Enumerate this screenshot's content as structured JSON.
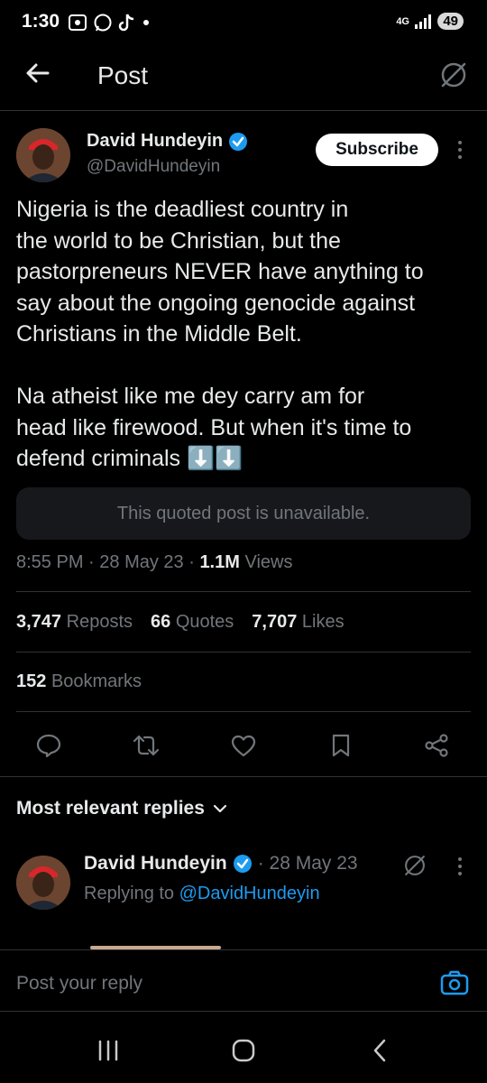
{
  "status_bar": {
    "time": "1:30",
    "network": "4G",
    "battery": "49"
  },
  "header": {
    "title": "Post"
  },
  "author": {
    "name": "David Hundeyin",
    "handle": "@DavidHundeyin"
  },
  "subscribe_label": "Subscribe",
  "tweet": {
    "text": "Nigeria is the deadliest country in\nthe world to be Christian, but the\npastorpreneurs NEVER have anything to\nsay about the ongoing genocide against\nChristians in the Middle Belt.\n\nNa atheist like me dey carry am for\nhead like firewood. But when it's time to\ndefend criminals ⬇️⬇️",
    "quoted_unavailable": "This quoted post is unavailable.",
    "time": "8:55 PM",
    "date": "28 May 23",
    "views_count": "1.1M",
    "views_label": "Views"
  },
  "stats": {
    "reposts_count": "3,747",
    "reposts_label": "Reposts",
    "quotes_count": "66",
    "quotes_label": "Quotes",
    "likes_count": "7,707",
    "likes_label": "Likes",
    "bookmarks_count": "152",
    "bookmarks_label": "Bookmarks"
  },
  "replies": {
    "heading": "Most relevant replies",
    "first": {
      "name": "David Hundeyin",
      "date": "· 28 May 23",
      "replying_prefix": "Replying to",
      "replying_to": "@DavidHundeyin"
    }
  },
  "reply_bar": {
    "placeholder": "Post your reply"
  },
  "colors": {
    "accent": "#1d9bf0",
    "background": "#000000",
    "muted": "#71767b"
  }
}
